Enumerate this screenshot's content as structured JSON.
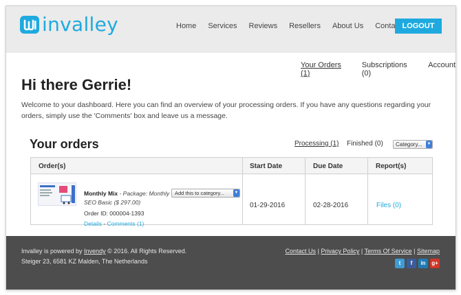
{
  "brand": {
    "name": "invalley",
    "accent": "#1eaadf"
  },
  "nav": [
    "Home",
    "Services",
    "Reviews",
    "Resellers",
    "About Us",
    "Contact us"
  ],
  "logout_label": "LOGOUT",
  "subnav": {
    "your_orders": "Your Orders (1)",
    "subscriptions": "Subscriptions (0)",
    "account": "Account"
  },
  "greeting": "Hi there Gerrie!",
  "intro": "Welcome to your dashboard. Here you can find an overview of your processing orders. If you have any questions regarding your orders, simply use the 'Comments' box and leave us a message.",
  "orders": {
    "title": "Your orders",
    "filter_processing": "Processing (1)",
    "filter_finished": "Finished (0)",
    "category_select": "Category...",
    "columns": [
      "Order(s)",
      "Start Date",
      "Due Date",
      "Report(s)"
    ],
    "row": {
      "product": "Monthly Mix",
      "package_prefix": " - ",
      "package": "Package: Monthly SEO Basic ($ 297.00)",
      "order_id": "Order ID: 000004-1393",
      "details": "Details",
      "separator": " - ",
      "comments": "Comments (1)",
      "add_category": "Add this to category...",
      "start_date": "01-29-2016",
      "due_date": "02-28-2016",
      "files": "Files (0)"
    }
  },
  "footer": {
    "powered_prefix": "Invalley is powered by ",
    "powered_link": "Invendy",
    "powered_suffix": " © 2016. All Rights Reserved.",
    "address": "Steiger 23, 6581 KZ Malden, The Netherlands",
    "links": [
      "Contact Us",
      "Privacy Policy",
      "Terms Of Service",
      "Sitemap"
    ],
    "link_sep": " | ",
    "socials": [
      "twitter-icon",
      "facebook-icon",
      "linkedin-icon",
      "google-plus-icon"
    ]
  }
}
